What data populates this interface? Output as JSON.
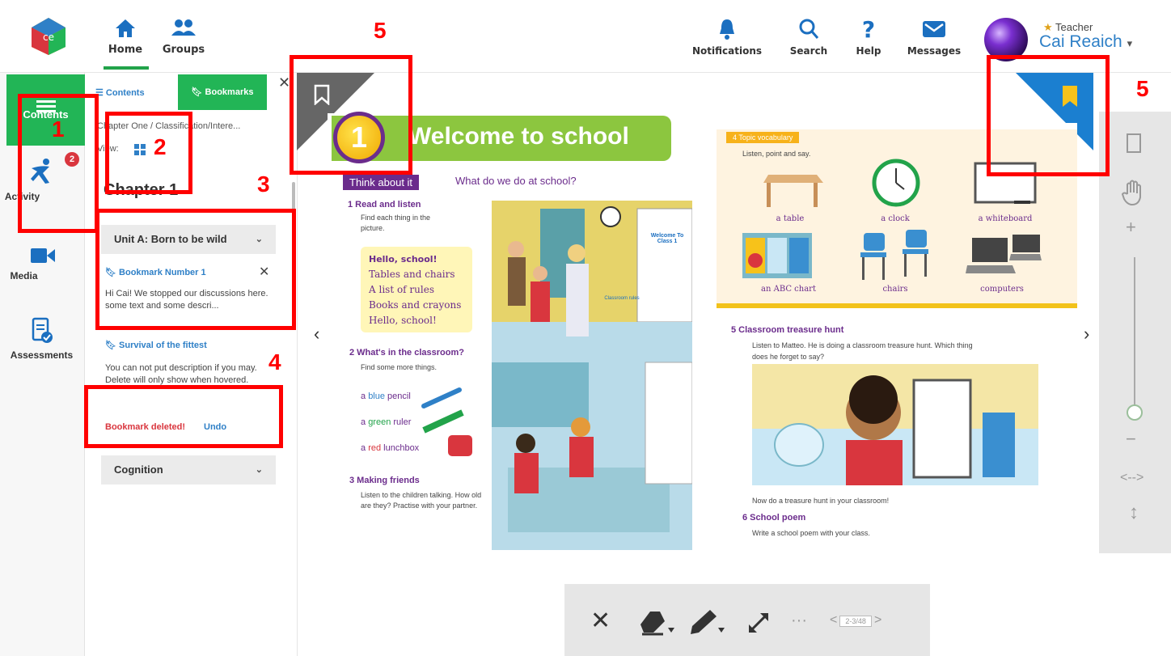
{
  "topbar": {
    "nav": [
      {
        "label": "Home",
        "icon": "home-icon"
      },
      {
        "label": "Groups",
        "icon": "groups-icon"
      }
    ],
    "actions": [
      {
        "label": "Notifications",
        "icon": "bell-icon"
      },
      {
        "label": "Search",
        "icon": "search-icon"
      },
      {
        "label": "Help",
        "icon": "help-icon"
      },
      {
        "label": "Messages",
        "icon": "mail-icon"
      }
    ],
    "user": {
      "role": "Teacher",
      "name": "Cai Reaich",
      "role_star": "★",
      "caret": "▾"
    }
  },
  "rail": {
    "contents_label": "Contents",
    "activity_label": "Activity",
    "activity_badge": "2",
    "media_label": "Media",
    "assessments_label": "Assessments"
  },
  "panel": {
    "tab_contents": "Contents",
    "tab_bookmarks": "Bookmarks",
    "close": "✕",
    "breadcrumb": "Chapter One / Classification/Intere...",
    "view_label": "View:",
    "chapter": "Chapter 1",
    "unit_a": "Unit A: Born to be wild",
    "bookmark1_title": "Bookmark Number 1",
    "bookmark1_desc": "Hi Cai! We stopped our discussions here. some text and some descri...",
    "bookmark2_title": "Survival of the fittest",
    "bookmark2_desc": "You can not put description if you may. Delete will only show when hovered.",
    "deleted_msg": "Bookmark deleted!",
    "undo": "Undo",
    "cognition": "Cognition"
  },
  "book_left": {
    "lesson_num": "1",
    "title": "Welcome to school",
    "think_label": "Think about it",
    "think_question": "What do we do at school?",
    "s1_title": "1 Read and listen",
    "s1_sub": "Find each thing in the picture.",
    "poem": [
      "Hello, school!",
      "Tables and chairs",
      "A list of rules",
      "Books and crayons",
      "Hello, school!"
    ],
    "s2_title": "2 What's in the classroom?",
    "s2_sub": "Find some more things.",
    "items": [
      {
        "pre": "a ",
        "color_word": "blue",
        "rest": " pencil",
        "color": "#2f80c7"
      },
      {
        "pre": "a ",
        "color_word": "green",
        "rest": " ruler",
        "color": "#22a34a"
      },
      {
        "pre": "a ",
        "color_word": "red",
        "rest": " lunchbox",
        "color": "#d9363e"
      }
    ],
    "s3_title": "3 Making friends",
    "s3_sub": "Listen to the children talking. How old are they? Practise with your partner.",
    "classroom_board": "Welcome To Class 1",
    "classroom_rules": "Classroom rules"
  },
  "book_right": {
    "topic_head": "4 Topic vocabulary",
    "topic_sub": "Listen, point and say.",
    "vocab": [
      "a table",
      "a clock",
      "a whiteboard",
      "an ABC chart",
      "chairs",
      "computers"
    ],
    "s5_title": "5 Classroom treasure hunt",
    "s5_sub": "Listen to Matteo. He is doing a classroom treasure hunt. Which thing does he forget to say?",
    "s5_after": "Now do a treasure hunt in your classroom!",
    "s6_title": "6 School poem",
    "s6_sub": "Write a school poem with your class."
  },
  "zoom": {
    "plus": "+",
    "minus": "−",
    "fit_width": "<-->",
    "fit_height": "↕"
  },
  "toolbar": {
    "close": "✕",
    "more": "···",
    "page": "2-3/48",
    "prev": "<",
    "next": ">"
  },
  "annotations": [
    "1",
    "2",
    "3",
    "4",
    "5",
    "5"
  ],
  "colors": {
    "green": "#22b556",
    "blue": "#2f80c7",
    "red": "#ff0000",
    "purple": "#6b2c8c"
  }
}
